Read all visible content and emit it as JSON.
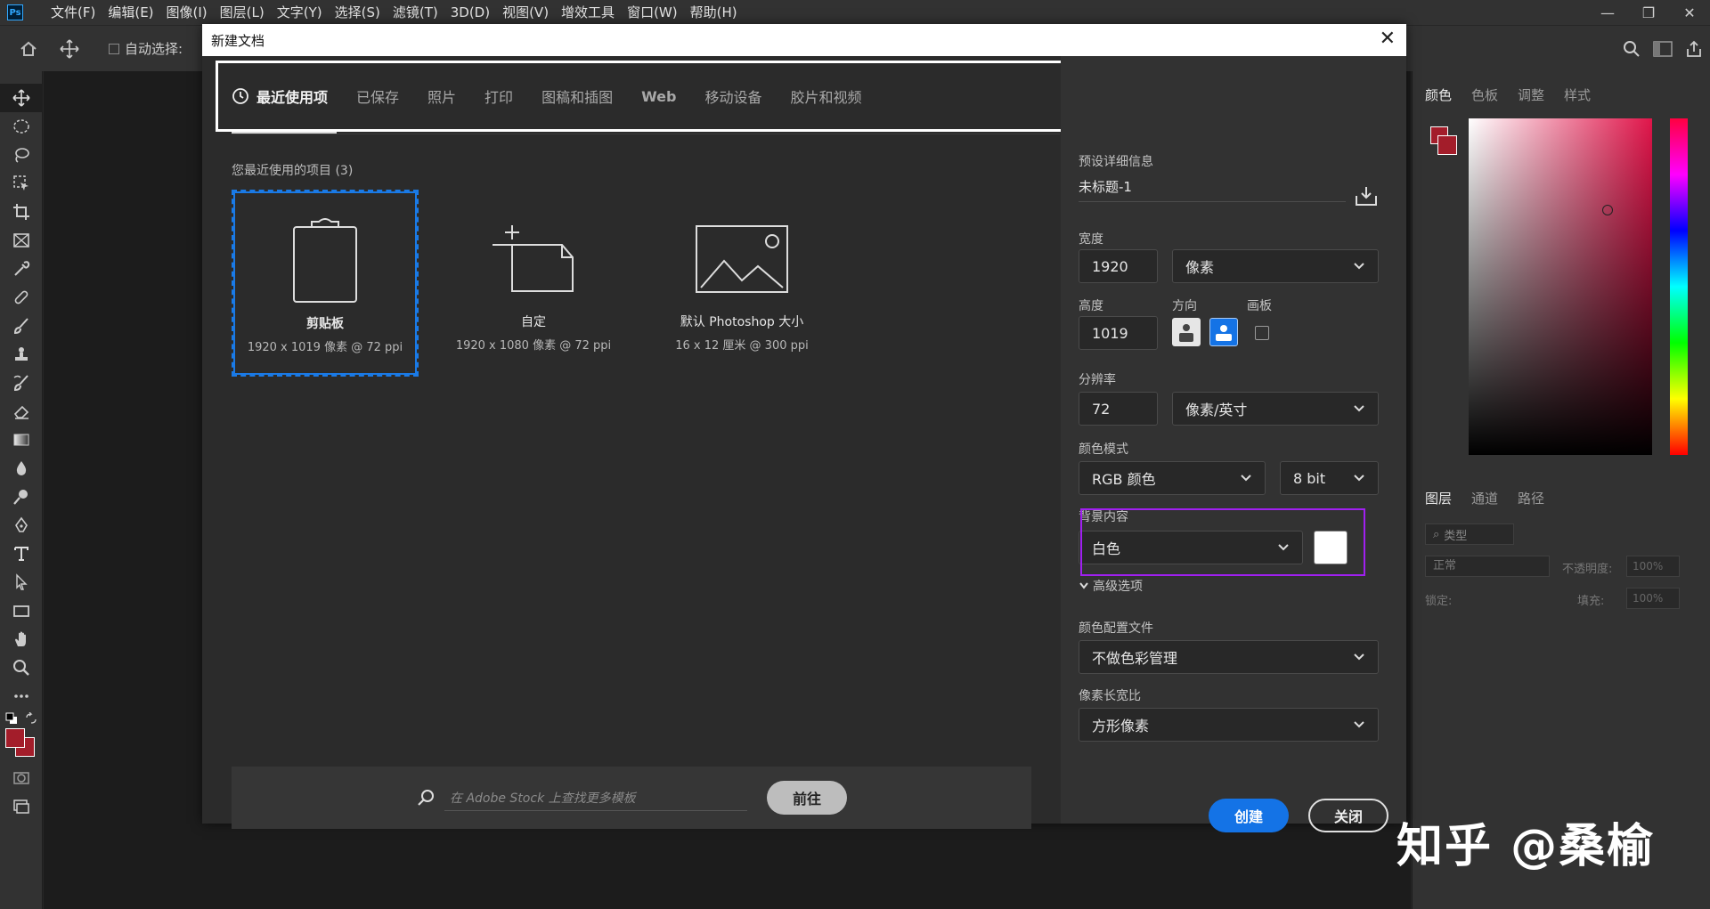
{
  "app": {
    "logo": "Ps"
  },
  "menu": [
    "文件(F)",
    "编辑(E)",
    "图像(I)",
    "图层(L)",
    "文字(Y)",
    "选择(S)",
    "滤镜(T)",
    "3D(D)",
    "视图(V)",
    "增效工具",
    "窗口(W)",
    "帮助(H)"
  ],
  "options": {
    "auto_select": "自动选择:"
  },
  "panels": {
    "color_tabs": [
      "颜色",
      "色板",
      "调整",
      "样式"
    ],
    "layer_tabs": [
      "图层",
      "通道",
      "路径"
    ],
    "layer_filter": "类型",
    "blend_mode": "正常",
    "opacity_label": "不透明度:",
    "opacity_value": "100%",
    "lock_label": "锁定:",
    "fill_label": "填充:",
    "fill_value": "100%"
  },
  "dialog": {
    "title": "新建文档",
    "tabs": [
      "最近使用项",
      "已保存",
      "照片",
      "打印",
      "图稿和插图",
      "Web",
      "移动设备",
      "胶片和视频"
    ],
    "recent_label": "您最近使用的项目 (3)",
    "cards": [
      {
        "name": "剪贴板",
        "sub": "1920 x 1019 像素 @ 72 ppi"
      },
      {
        "name": "自定",
        "sub": "1920 x 1080 像素 @ 72 ppi"
      },
      {
        "name": "默认 Photoshop 大小",
        "sub": "16 x 12 厘米 @ 300 ppi"
      }
    ],
    "stock_placeholder": "在 Adobe Stock 上查找更多模板",
    "stock_button": "前往",
    "preset_label": "预设详细信息",
    "doc_name": "未标题-1",
    "width_label": "宽度",
    "width_value": "1920",
    "width_unit": "像素",
    "height_label": "高度",
    "height_value": "1019",
    "orientation_label": "方向",
    "artboard_label": "画板",
    "resolution_label": "分辨率",
    "resolution_value": "72",
    "resolution_unit": "像素/英寸",
    "color_mode_label": "颜色模式",
    "color_mode_value": "RGB 颜色",
    "bit_depth": "8 bit",
    "background_label": "背景内容",
    "background_value": "白色",
    "advanced_label": "高级选项",
    "color_profile_label": "颜色配置文件",
    "color_profile_value": "不做色彩管理",
    "pixel_aspect_label": "像素长宽比",
    "pixel_aspect_value": "方形像素",
    "create_button": "创建",
    "close_button": "关闭"
  },
  "watermark": "知乎 @桑榆",
  "colors": {
    "foreground": "#a31d2a",
    "accent": "#1473e6",
    "highlight": "#a020f0"
  }
}
